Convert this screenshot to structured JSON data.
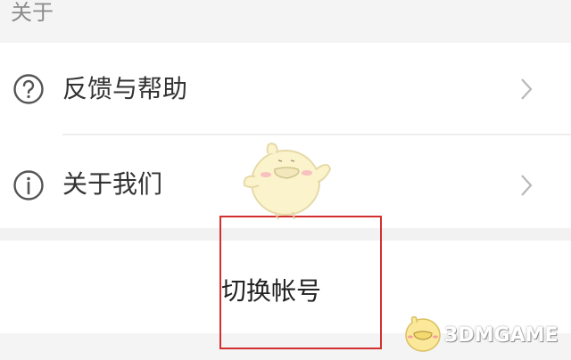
{
  "section": {
    "title": "关于"
  },
  "list": {
    "items": [
      {
        "label": "反馈与帮助",
        "icon": "question-circle-icon"
      },
      {
        "label": "关于我们",
        "icon": "info-circle-icon"
      }
    ]
  },
  "switch_account": {
    "label": "切换帐号"
  },
  "watermark": {
    "text": "3DMGAME"
  },
  "colors": {
    "highlight": "#d32f2f",
    "icon": "#555555",
    "chevron": "#b8b8b8"
  }
}
